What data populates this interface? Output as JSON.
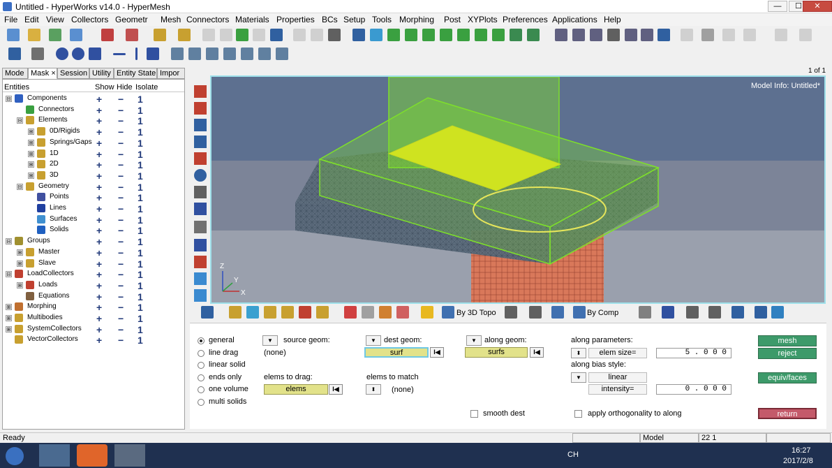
{
  "window": {
    "title": "Untitled - HyperWorks v14.0 - HyperMesh",
    "controls": [
      "—",
      "☐",
      "✕"
    ]
  },
  "menu": [
    "File",
    "Edit",
    "View",
    "Collectors",
    "Geometr",
    "Mesh",
    "Connectors",
    "Materials",
    "Properties",
    "BCs",
    "Setup",
    "Tools",
    "Morphing",
    "Post",
    "XYPlots",
    "Preferences",
    "Applications",
    "Help"
  ],
  "left_tabs": [
    "Mode",
    "Mask ×",
    "Session",
    "Utility",
    "Entity State",
    "Impor"
  ],
  "browser": {
    "headers": {
      "entities": "Entities",
      "show": "Show",
      "hide": "Hide",
      "isolate": "Isolate"
    },
    "plus": "+",
    "minus": "−",
    "one": "1",
    "rows": [
      {
        "label": "Components",
        "level": 0,
        "expander": "⊟",
        "color": "#3060c0"
      },
      {
        "label": "Connectors",
        "level": 1,
        "expander": "",
        "color": "#3aa040"
      },
      {
        "label": "Elements",
        "level": 1,
        "expander": "⊟",
        "color": "#c8a030"
      },
      {
        "label": "0D/Rigids",
        "level": 2,
        "expander": "⊞",
        "color": "#c8a030"
      },
      {
        "label": "Springs/Gaps",
        "level": 2,
        "expander": "⊞",
        "color": "#c8a030"
      },
      {
        "label": "1D",
        "level": 2,
        "expander": "⊞",
        "color": "#c8a030"
      },
      {
        "label": "2D",
        "level": 2,
        "expander": "⊞",
        "color": "#c8a030"
      },
      {
        "label": "3D",
        "level": 2,
        "expander": "⊞",
        "color": "#c8a030"
      },
      {
        "label": "Geometry",
        "level": 1,
        "expander": "⊟",
        "color": "#c8a030"
      },
      {
        "label": "Points",
        "level": 2,
        "expander": "",
        "color": "#4050a0"
      },
      {
        "label": "Lines",
        "level": 2,
        "expander": "",
        "color": "#2040a0"
      },
      {
        "label": "Surfaces",
        "level": 2,
        "expander": "",
        "color": "#4090d0"
      },
      {
        "label": "Solids",
        "level": 2,
        "expander": "",
        "color": "#2060c0"
      },
      {
        "label": "Groups",
        "level": 0,
        "expander": "⊟",
        "color": "#a09030"
      },
      {
        "label": "Master",
        "level": 1,
        "expander": "⊞",
        "color": "#c8a030"
      },
      {
        "label": "Slave",
        "level": 1,
        "expander": "⊞",
        "color": "#c8a030"
      },
      {
        "label": "LoadCollectors",
        "level": 0,
        "expander": "⊟",
        "color": "#c04030"
      },
      {
        "label": "Loads",
        "level": 1,
        "expander": "⊞",
        "color": "#c04030"
      },
      {
        "label": "Equations",
        "level": 1,
        "expander": "",
        "color": "#806040"
      },
      {
        "label": "Morphing",
        "level": 0,
        "expander": "⊞",
        "color": "#c07030"
      },
      {
        "label": "Multibodies",
        "level": 0,
        "expander": "⊞",
        "color": "#c8a030"
      },
      {
        "label": "SystemCollectors",
        "level": 0,
        "expander": "⊞",
        "color": "#c8a030"
      },
      {
        "label": "VectorCollectors",
        "level": 0,
        "expander": "",
        "color": "#c8a030"
      }
    ]
  },
  "viewport": {
    "page": "1 of 1",
    "model_info": "Model Info: Untitled*",
    "axes": {
      "z": "Z",
      "y": "Y",
      "x": "X"
    }
  },
  "viewport_toolbar": {
    "by_3d_topo": "By 3D Topo",
    "by_comp": "By Comp"
  },
  "panel": {
    "modes": [
      {
        "label": "general",
        "selected": true
      },
      {
        "label": "line drag",
        "selected": false
      },
      {
        "label": "linear solid",
        "selected": false
      },
      {
        "label": "ends only",
        "selected": false
      },
      {
        "label": "one volume",
        "selected": false
      },
      {
        "label": "multi solids",
        "selected": false
      }
    ],
    "source_geom_label": "source geom:",
    "source_geom_value": "(none)",
    "dest_geom_label": "dest geom:",
    "dest_geom_value": "surf",
    "along_geom_label": "along geom:",
    "along_geom_value": "surfs",
    "elems_to_drag_label": "elems to drag:",
    "elems_to_drag_value": "elems",
    "elems_to_match_label": "elems to match",
    "elems_to_match_value": "(none)",
    "along_parameters_label": "along parameters:",
    "elem_size_label": "elem size=",
    "elem_size_value": "5 . 0 0 0",
    "bias_style_label": "along bias style:",
    "bias_style_value": "linear",
    "intensity_label": "intensity=",
    "intensity_value": "0 . 0 0 0",
    "smooth_dest": "smooth dest",
    "apply_orthogonality": "apply orthogonality to along",
    "buttons": {
      "mesh": "mesh",
      "reject": "reject",
      "equiv": "equiv/faces",
      "return": "return"
    },
    "skip_glyph": "I◀",
    "dd_glyph": "▼",
    "updown_glyph": "⬍"
  },
  "status": {
    "ready": "Ready",
    "model": "Model",
    "component": "22 1"
  },
  "taskbar": {
    "time": "16:27",
    "date": "2017/2/8",
    "lang": "CH"
  },
  "colors": {
    "mesh_green": "#7ee02a",
    "yellow_face": "#cfe320",
    "cylinder": "#d9785a",
    "viewport_bg": "#80899e"
  }
}
